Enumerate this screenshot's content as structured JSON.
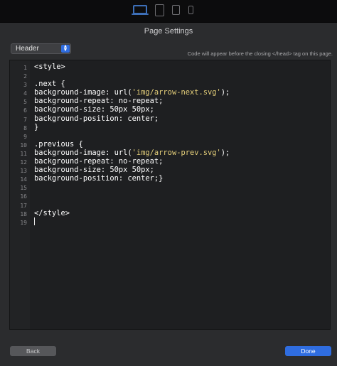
{
  "toolbar": {
    "devices": [
      "laptop-icon",
      "tablet-landscape-icon",
      "tablet-portrait-icon",
      "phone-icon"
    ],
    "active_device": "laptop-icon",
    "accent_color": "#3d6fb8"
  },
  "dialog": {
    "title": "Page Settings",
    "location_select": {
      "value": "Header"
    },
    "hint": "Code will appear before the closing </head> tag on this page."
  },
  "editor": {
    "line_numbers": [
      "1",
      "2",
      "3",
      "4",
      "5",
      "6",
      "7",
      "8",
      "9",
      "10",
      "11",
      "12",
      "13",
      "14",
      "15",
      "16",
      "17",
      "18",
      "19"
    ],
    "lines": [
      [
        "<style>"
      ],
      [
        ""
      ],
      [
        ".next {"
      ],
      [
        "background-image: url(",
        "'img/arrow-next.svg'",
        ");"
      ],
      [
        "background-repeat: no-repeat;"
      ],
      [
        "background-size: 50px 50px;"
      ],
      [
        "background-position: center;"
      ],
      [
        "}"
      ],
      [
        ""
      ],
      [
        ".previous {"
      ],
      [
        "background-image: url(",
        "'img/arrow-prev.svg'",
        ");"
      ],
      [
        "background-repeat: no-repeat;"
      ],
      [
        "background-size: 50px 50px;"
      ],
      [
        "background-position: center;}"
      ],
      [
        ""
      ],
      [
        ""
      ],
      [
        ""
      ],
      [
        "</style>"
      ],
      [
        ""
      ]
    ],
    "string_color": "#e5cf7a"
  },
  "footer": {
    "back_label": "Back",
    "done_label": "Done",
    "primary_color": "#2f6de0"
  }
}
